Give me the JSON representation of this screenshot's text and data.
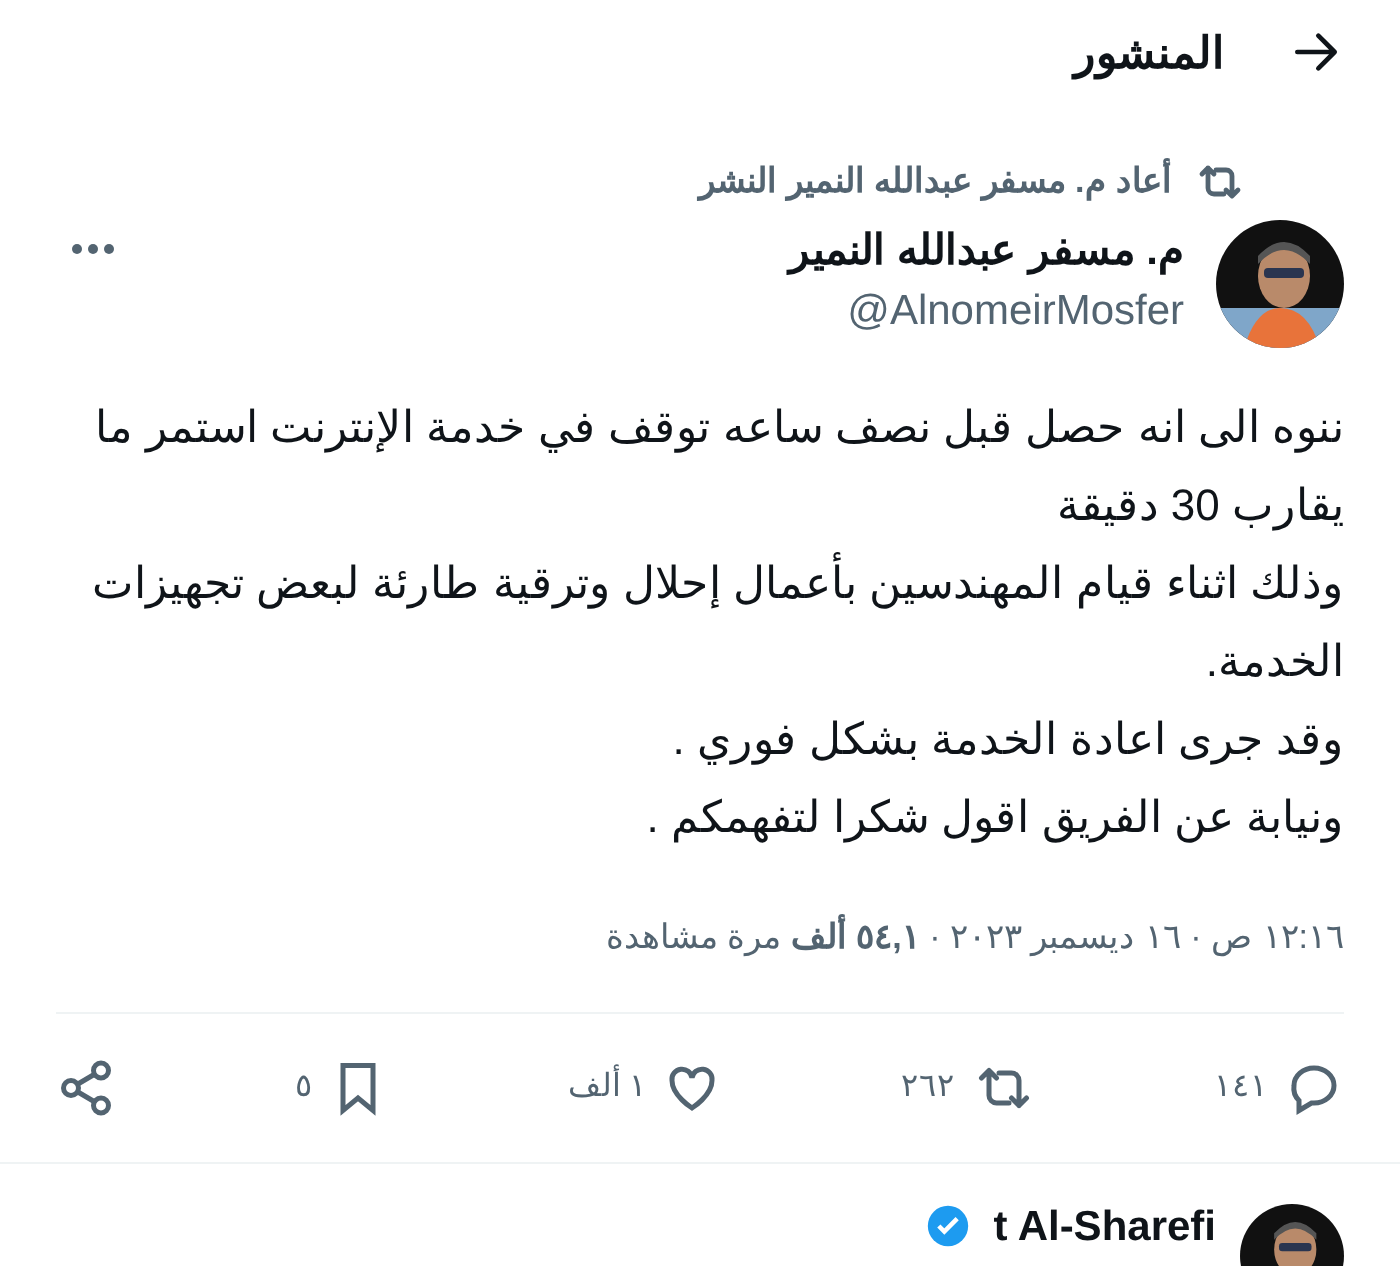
{
  "header": {
    "title": "المنشور"
  },
  "retweeted_by": "أعاد م. مسفر عبدالله النمير النشر",
  "author": {
    "name": "م. مسفر عبدالله النمير",
    "handle": "@AlnomeirMosfer"
  },
  "body": [
    "ننوه الى انه حصل قبل نصف ساعه توقف في خدمة الإنترنت استمر ما يقارب 30 دقيقة",
    "وذلك اثناء قيام المهندسين بأعمال إحلال وترقية طارئة لبعض تجهيزات الخدمة.",
    "وقد جرى اعادة الخدمة بشكل فوري .",
    "ونيابة عن الفريق اقول شكرا لتفهمكم ."
  ],
  "meta": "١٢:١٦ ص · ١٦ ديسمبر ٢٠٢٣ · **٥٤,١ ألف** مرة مشاهدة",
  "actions": [
    {
      "kind": "reply",
      "count": "١٤١"
    },
    {
      "kind": "retweet",
      "count": "٢٦٢"
    },
    {
      "kind": "like",
      "count": "١ ألف"
    },
    {
      "kind": "bookmark",
      "count": "٥"
    },
    {
      "kind": "share"
    }
  ],
  "next_reply": {
    "name": "t Al-Sharefi",
    "verified": true
  }
}
